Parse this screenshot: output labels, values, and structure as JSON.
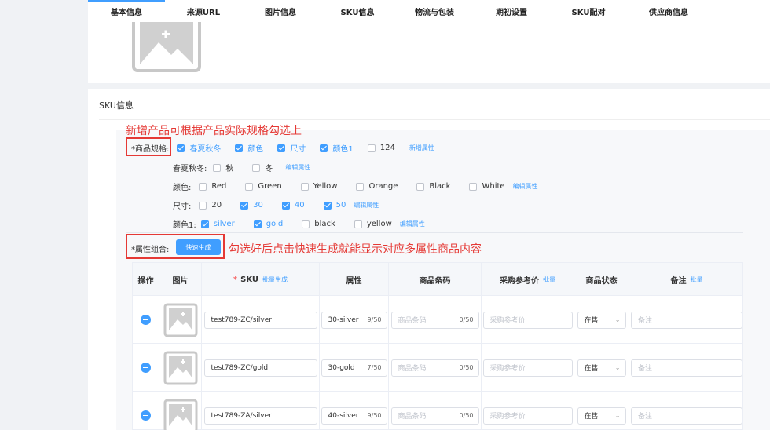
{
  "tabs": [
    "基本信息",
    "来源URL",
    "图片信息",
    "SKU信息",
    "物流与包装",
    "期初设置",
    "SKU配对",
    "供应商信息"
  ],
  "section": {
    "title": "SKU信息"
  },
  "annotations": {
    "spec": "新增产品可根据产品实际规格勾选上",
    "combo": "勾选好后点击快速生成就能显示对应多属性商品内容"
  },
  "spec": {
    "label": "*商品规格:",
    "options": [
      {
        "label": "春夏秋冬",
        "checked": true
      },
      {
        "label": "颜色",
        "checked": true
      },
      {
        "label": "尺寸",
        "checked": true
      },
      {
        "label": "颜色1",
        "checked": true
      },
      {
        "label": "124",
        "checked": false
      }
    ],
    "add_link": "新增属性"
  },
  "attributes": [
    {
      "label": "春夏秋冬:",
      "values": [
        {
          "label": "秋",
          "checked": false
        },
        {
          "label": "冬",
          "checked": false
        }
      ],
      "edit": "编辑属性"
    },
    {
      "label": "颜色:",
      "values": [
        {
          "label": "Red",
          "checked": false
        },
        {
          "label": "Green",
          "checked": false
        },
        {
          "label": "Yellow",
          "checked": false
        },
        {
          "label": "Orange",
          "checked": false
        },
        {
          "label": "Black",
          "checked": false
        },
        {
          "label": "White",
          "checked": false
        }
      ],
      "edit": "编辑属性"
    },
    {
      "label": "尺寸:",
      "values": [
        {
          "label": "20",
          "checked": false
        },
        {
          "label": "30",
          "checked": true
        },
        {
          "label": "40",
          "checked": true
        },
        {
          "label": "50",
          "checked": true
        }
      ],
      "edit": "编辑属性"
    },
    {
      "label": "颜色1:",
      "values": [
        {
          "label": "silver",
          "checked": true
        },
        {
          "label": "gold",
          "checked": true
        },
        {
          "label": "black",
          "checked": false
        },
        {
          "label": "yellow",
          "checked": false
        }
      ],
      "edit": "编辑属性"
    }
  ],
  "combo": {
    "label": "*属性组合:",
    "button": "快速生成"
  },
  "table": {
    "headers": {
      "op": "操作",
      "img": "图片",
      "sku_star": "*",
      "sku": "SKU",
      "sku_link": "批量生成",
      "attr": "属性",
      "barcode": "商品条码",
      "price": "采购参考价",
      "price_link": "批量",
      "status": "商品状态",
      "note": "备注",
      "note_link": "批量"
    },
    "placeholders": {
      "barcode": "商品条码",
      "price": "采购参考价",
      "note": "备注"
    },
    "rows": [
      {
        "sku": "test789-ZC/silver",
        "attr": "30-silver",
        "attr_count": "9/50",
        "barcode_count": "0/50",
        "status": "在售"
      },
      {
        "sku": "test789-ZC/gold",
        "attr": "30-gold",
        "attr_count": "7/50",
        "barcode_count": "0/50",
        "status": "在售"
      },
      {
        "sku": "test789-ZA/silver",
        "attr": "40-silver",
        "attr_count": "9/50",
        "barcode_count": "0/50",
        "status": "在售"
      }
    ]
  },
  "colors": {
    "accent": "#409eff",
    "annotation": "#e53935"
  }
}
